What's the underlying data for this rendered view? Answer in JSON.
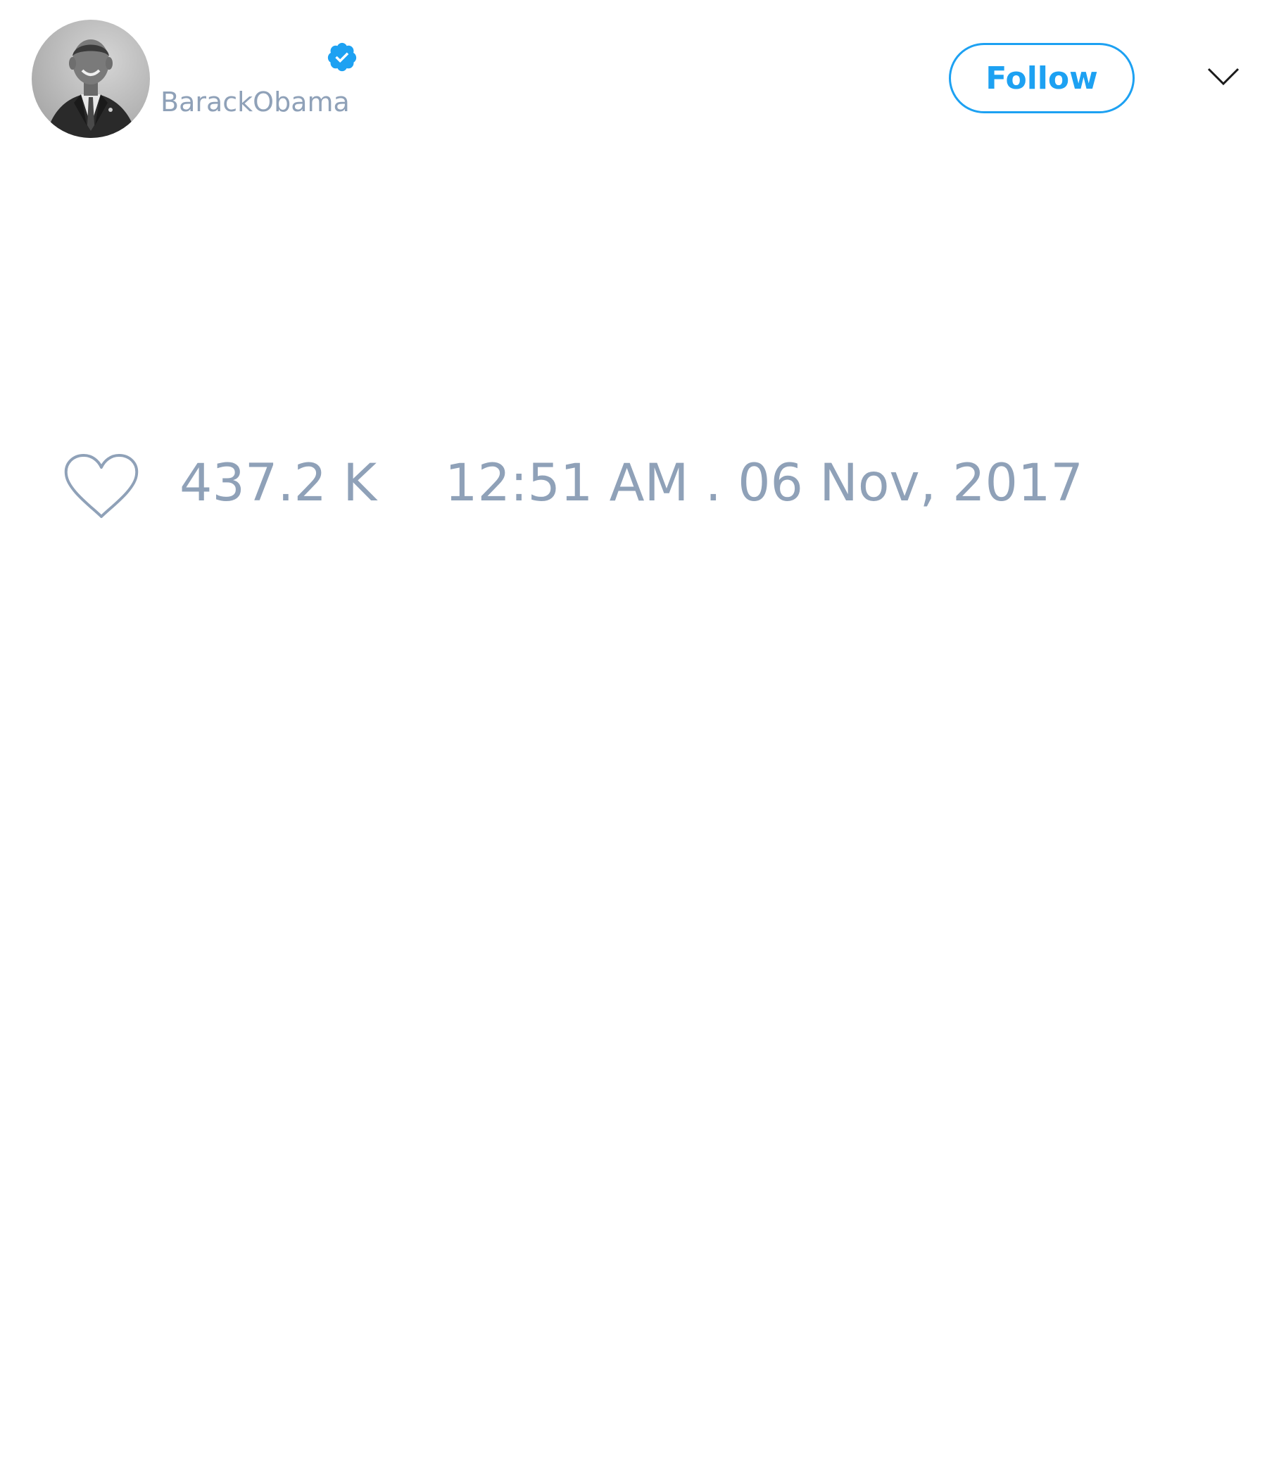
{
  "author": {
    "handle": "BarackObama",
    "verified": true,
    "verified_icon": "verified-badge-icon",
    "avatar": "profile-photo-grayscale"
  },
  "actions": {
    "follow_label": "Follow",
    "menu_icon": "chevron-down-icon"
  },
  "stats": {
    "like_icon": "heart-outline-icon",
    "like_count": "437.2 K",
    "timestamp": "12:51 AM . 06 Nov, 2017"
  },
  "colors": {
    "accent": "#1da1f2",
    "muted_text": "#8fa1b8",
    "background": "#ffffff"
  }
}
